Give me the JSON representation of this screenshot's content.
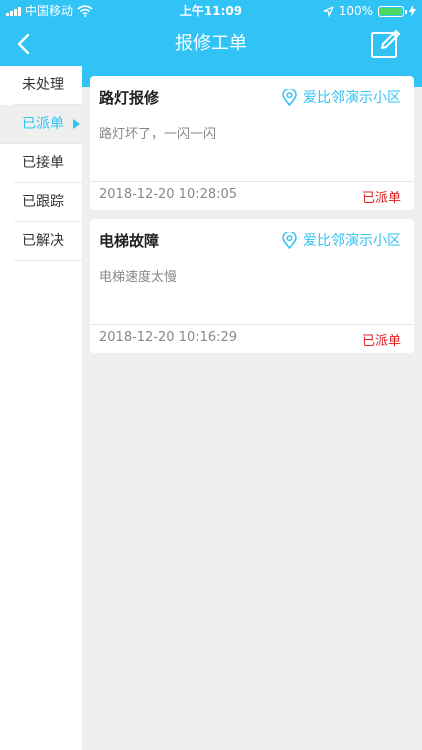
{
  "status_bar": {
    "carrier": "中国移动",
    "time": "上午11:09",
    "battery_percent": "100%",
    "battery_level": 1.0
  },
  "navbar": {
    "title": "报修工单",
    "back_icon": "chevron-left-icon",
    "edit_icon": "edit-icon"
  },
  "sidebar": {
    "items": [
      {
        "label": "未处理"
      },
      {
        "label": "已派单"
      },
      {
        "label": "已接单"
      },
      {
        "label": "已跟踪"
      },
      {
        "label": "已解决"
      }
    ],
    "active_index": 1
  },
  "orders": [
    {
      "title": "路灯报修",
      "location": "爱比邻演示小区",
      "description": "路灯坏了，一闪一闪",
      "time": "2018-12-20 10:28:05",
      "status": "已派单"
    },
    {
      "title": "电梯故障",
      "location": "爱比邻演示小区",
      "description": "电梯速度太慢",
      "time": "2018-12-20 10:16:29",
      "status": "已派单"
    }
  ],
  "colors": {
    "accent": "#31c3f5",
    "status_red": "#e02020",
    "background": "#efefef"
  }
}
